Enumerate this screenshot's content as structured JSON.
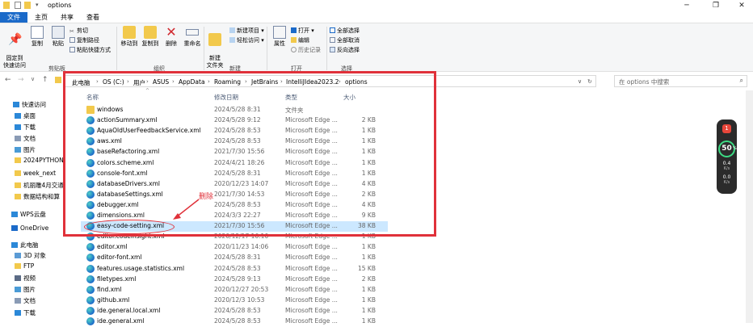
{
  "title": {
    "folder_name": "options"
  },
  "window_controls": {
    "minimize": "─",
    "maximize": "❐",
    "close": "✕"
  },
  "tabs": {
    "file": "文件",
    "home": "主页",
    "share": "共享",
    "view": "查看"
  },
  "ribbon": {
    "pin": "固定到\n快速访问",
    "copy": "复制",
    "paste": "粘贴",
    "cut": "剪切",
    "copy_path": "复制路径",
    "paste_shortcut": "粘贴快捷方式",
    "move_to": "移动到",
    "copy_to": "复制到",
    "delete": "删除",
    "rename": "重命名",
    "new_folder": "新建\n文件夹",
    "new_item": "新建项目 ▾",
    "easy_access": "轻松访问 ▾",
    "properties": "属性",
    "open": "打开 ▾",
    "edit": "编辑",
    "history": "历史记录",
    "select_all": "全部选择",
    "select_none": "全部取消",
    "invert": "反向选择",
    "group_clipboard": "剪贴板",
    "group_organize": "组织",
    "group_new": "新建",
    "group_open": "打开",
    "group_select": "选择"
  },
  "address": {
    "crumbs": [
      "此电脑",
      "OS (C:)",
      "用户",
      "ASUS",
      "AppData",
      "Roaming",
      "JetBrains",
      "IntelliJIdea2023.2",
      "options"
    ],
    "search_placeholder": "在 options 中搜索"
  },
  "nav": {
    "items": [
      {
        "label": "快速访问",
        "icon": "star-icon"
      },
      {
        "label": "桌面",
        "icon": "desktop-icon"
      },
      {
        "label": "下载",
        "icon": "download-icon"
      },
      {
        "label": "文档",
        "icon": "document-icon"
      },
      {
        "label": "图片",
        "icon": "picture-icon"
      },
      {
        "label": "2024PYTHON",
        "icon": "folder-icon"
      },
      {
        "label": "week_next",
        "icon": "folder-icon"
      },
      {
        "label": "机丽雕4月交通",
        "icon": "folder-icon"
      },
      {
        "label": "数据结构和算",
        "icon": "folder-icon"
      },
      {
        "label": "WPS云盘",
        "icon": "cloud-icon"
      },
      {
        "label": "OneDrive",
        "icon": "onedrive-icon"
      },
      {
        "label": "此电脑",
        "icon": "computer-icon"
      },
      {
        "label": "3D 对象",
        "icon": "cube-icon"
      },
      {
        "label": "FTP",
        "icon": "folder-icon"
      },
      {
        "label": "视频",
        "icon": "video-icon"
      },
      {
        "label": "图片",
        "icon": "picture-icon"
      },
      {
        "label": "文档",
        "icon": "document-icon"
      },
      {
        "label": "下载",
        "icon": "download-icon"
      }
    ]
  },
  "columns": {
    "name": "名称",
    "date": "修改日期",
    "type": "类型",
    "size": "大小"
  },
  "files": [
    {
      "name": "windows",
      "date": "2024/5/28 8:31",
      "type": "文件夹",
      "size": "",
      "icon": "folder"
    },
    {
      "name": "actionSummary.xml",
      "date": "2024/5/28 9:12",
      "type": "Microsoft Edge ...",
      "size": "2 KB",
      "icon": "edge"
    },
    {
      "name": "AquaOldUserFeedbackService.xml",
      "date": "2024/5/28 8:53",
      "type": "Microsoft Edge ...",
      "size": "1 KB",
      "icon": "edge"
    },
    {
      "name": "aws.xml",
      "date": "2024/5/28 8:53",
      "type": "Microsoft Edge ...",
      "size": "1 KB",
      "icon": "edge"
    },
    {
      "name": "baseRefactoring.xml",
      "date": "2021/7/30 15:56",
      "type": "Microsoft Edge ...",
      "size": "1 KB",
      "icon": "edge"
    },
    {
      "name": "colors.scheme.xml",
      "date": "2024/4/21 18:26",
      "type": "Microsoft Edge ...",
      "size": "1 KB",
      "icon": "edge"
    },
    {
      "name": "console-font.xml",
      "date": "2024/5/28 8:31",
      "type": "Microsoft Edge ...",
      "size": "1 KB",
      "icon": "edge"
    },
    {
      "name": "databaseDrivers.xml",
      "date": "2020/12/23 14:07",
      "type": "Microsoft Edge ...",
      "size": "4 KB",
      "icon": "edge"
    },
    {
      "name": "databaseSettings.xml",
      "date": "2021/7/30 14:53",
      "type": "Microsoft Edge ...",
      "size": "2 KB",
      "icon": "edge"
    },
    {
      "name": "debugger.xml",
      "date": "2024/5/28 8:53",
      "type": "Microsoft Edge ...",
      "size": "4 KB",
      "icon": "edge"
    },
    {
      "name": "dimensions.xml",
      "date": "2024/3/3 22:27",
      "type": "Microsoft Edge ...",
      "size": "9 KB",
      "icon": "edge"
    },
    {
      "name": "easy-code-setting.xml",
      "date": "2021/7/30 15:56",
      "type": "Microsoft Edge ...",
      "size": "38 KB",
      "icon": "edge",
      "selected": true
    },
    {
      "name": "editor.codeinsight.xml",
      "date": "2020/12/17 16:10",
      "type": "Microsoft Edge ...",
      "size": "1 KB",
      "icon": "edge"
    },
    {
      "name": "editor.xml",
      "date": "2020/11/23 14:06",
      "type": "Microsoft Edge ...",
      "size": "1 KB",
      "icon": "edge"
    },
    {
      "name": "editor-font.xml",
      "date": "2024/5/28 8:31",
      "type": "Microsoft Edge ...",
      "size": "1 KB",
      "icon": "edge"
    },
    {
      "name": "features.usage.statistics.xml",
      "date": "2024/5/28 8:53",
      "type": "Microsoft Edge ...",
      "size": "15 KB",
      "icon": "edge"
    },
    {
      "name": "filetypes.xml",
      "date": "2024/5/28 9:13",
      "type": "Microsoft Edge ...",
      "size": "2 KB",
      "icon": "edge"
    },
    {
      "name": "find.xml",
      "date": "2020/12/27 20:53",
      "type": "Microsoft Edge ...",
      "size": "1 KB",
      "icon": "edge"
    },
    {
      "name": "github.xml",
      "date": "2020/12/3 10:53",
      "type": "Microsoft Edge ...",
      "size": "1 KB",
      "icon": "edge"
    },
    {
      "name": "ide.general.local.xml",
      "date": "2024/5/28 8:53",
      "type": "Microsoft Edge ...",
      "size": "1 KB",
      "icon": "edge"
    },
    {
      "name": "ide.general.xml",
      "date": "2024/5/28 8:53",
      "type": "Microsoft Edge ...",
      "size": "1 KB",
      "icon": "edge"
    }
  ],
  "annotation": {
    "delete_note": "删除"
  },
  "widget": {
    "badge": "1",
    "score": "50",
    "score_unit": "%",
    "up_speed": "0.4",
    "down_speed": "0.0",
    "speed_unit": "K/s"
  },
  "colors": {
    "accent": "#1b6ac9",
    "annotation": "#e0313a",
    "selection": "#cce8ff"
  }
}
